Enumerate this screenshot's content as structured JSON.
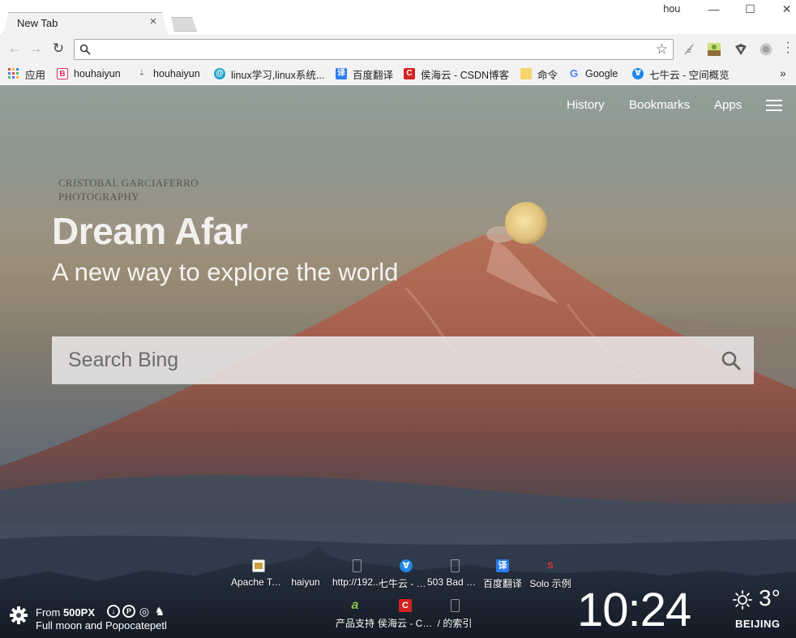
{
  "browser": {
    "tab_title": "New Tab",
    "tab_close": "×",
    "profile_name": "hou",
    "window_buttons": {
      "minimize": "—",
      "maximize": "☐",
      "close": "✕"
    },
    "omnibox": {
      "value": "",
      "placeholder": ""
    },
    "bookmarks": [
      {
        "label": "应用",
        "icon": "apps-grid-icon",
        "color": "#e8453c"
      },
      {
        "label": "houhaiyun",
        "icon": "bookmark-favicon",
        "color": "#d8315b"
      },
      {
        "label": "houhaiyun",
        "icon": "person-favicon",
        "color": "#9a9a9a"
      },
      {
        "label": "linux学习,linux系统...",
        "icon": "linux-favicon",
        "color": "#1da1c8"
      },
      {
        "label": "百度翻译",
        "icon": "translate-favicon",
        "color": "#2b7bf0"
      },
      {
        "label": "侯海云 - CSDN博客",
        "icon": "csdn-favicon",
        "color": "#d22222"
      },
      {
        "label": "命令",
        "icon": "folder-icon",
        "color": "#f5d46b"
      },
      {
        "label": "Google",
        "icon": "google-favicon",
        "color": "#4285f4"
      },
      {
        "label": "七牛云 - 空间概览",
        "icon": "qiniu-favicon",
        "color": "#1e88e5"
      }
    ],
    "bookmarks_more": "»"
  },
  "page": {
    "nav": {
      "history": "History",
      "bookmarks": "Bookmarks",
      "apps": "Apps"
    },
    "photographer_line1": "CRISTOBAL GARCIAFERRO",
    "photographer_line2": "PHOTOGRAPHY",
    "title": "Dream Afar",
    "subtitle": "A new way to explore the world",
    "search": {
      "placeholder": "Search Bing"
    },
    "tiles": [
      {
        "label": "Apache Tom...",
        "icon": "image-favicon",
        "color": "#c8a040"
      },
      {
        "label": "haiyun",
        "icon": "blank-favicon",
        "color": "rgba(0,0,0,0)"
      },
      {
        "label": "http://192...",
        "icon": "page-favicon",
        "color": "rgba(0,0,0,0)"
      },
      {
        "label": "七牛云 - 空...",
        "icon": "qiniu-favicon",
        "color": "#1e88e5"
      },
      {
        "label": "503 Bad Ga...",
        "icon": "page-favicon",
        "color": "rgba(0,0,0,0)"
      },
      {
        "label": "百度翻译",
        "icon": "translate-favicon",
        "color": "#2b7bf0"
      },
      {
        "label": "Solo 示例",
        "icon": "solo-favicon",
        "color": "#e53935"
      },
      {
        "label": "产品支持",
        "icon": "product-favicon",
        "color": "#8bc34a"
      },
      {
        "label": "侯海云 - CS...",
        "icon": "csdn-favicon",
        "color": "#d22222"
      },
      {
        "label": "/ 的索引",
        "icon": "page-favicon",
        "color": "rgba(0,0,0,0)"
      }
    ],
    "credit": {
      "from_prefix": "From ",
      "source": "500PX",
      "photo_name": "Full moon and Popocatepetl"
    },
    "clock": "10:24",
    "weather": {
      "temp": "3°",
      "city": "BEIJING",
      "icon": "sun-icon"
    }
  }
}
